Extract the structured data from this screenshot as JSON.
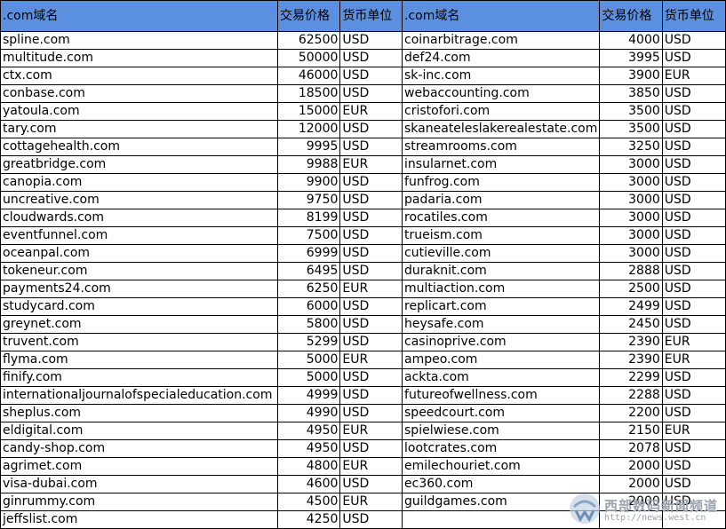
{
  "headers": {
    "domain": ".com域名",
    "price": "交易价格",
    "currency": "货币单位"
  },
  "left": [
    {
      "domain": "spline.com",
      "price": "62500",
      "currency": "USD"
    },
    {
      "domain": "multitude.com",
      "price": "50000",
      "currency": "USD"
    },
    {
      "domain": "ctx.com",
      "price": "46000",
      "currency": "USD"
    },
    {
      "domain": "conbase.com",
      "price": "18500",
      "currency": "USD"
    },
    {
      "domain": "yatoula.com",
      "price": "15000",
      "currency": "EUR"
    },
    {
      "domain": "tary.com",
      "price": "12000",
      "currency": "USD"
    },
    {
      "domain": "cottagehealth.com",
      "price": "9995",
      "currency": "USD"
    },
    {
      "domain": "greatbridge.com",
      "price": "9988",
      "currency": "EUR"
    },
    {
      "domain": "canopia.com",
      "price": "9900",
      "currency": "USD"
    },
    {
      "domain": "uncreative.com",
      "price": "9750",
      "currency": "USD"
    },
    {
      "domain": "cloudwards.com",
      "price": "8199",
      "currency": "USD"
    },
    {
      "domain": "eventfunnel.com",
      "price": "7500",
      "currency": "USD"
    },
    {
      "domain": "oceanpal.com",
      "price": "6999",
      "currency": "USD"
    },
    {
      "domain": "tokeneur.com",
      "price": "6495",
      "currency": "USD"
    },
    {
      "domain": "payments24.com",
      "price": "6250",
      "currency": "EUR"
    },
    {
      "domain": "studycard.com",
      "price": "6000",
      "currency": "USD"
    },
    {
      "domain": "greynet.com",
      "price": "5800",
      "currency": "USD"
    },
    {
      "domain": "truvent.com",
      "price": "5299",
      "currency": "USD"
    },
    {
      "domain": "flyma.com",
      "price": "5000",
      "currency": "EUR"
    },
    {
      "domain": "finify.com",
      "price": "5000",
      "currency": "USD"
    },
    {
      "domain": "internationaljournalofspecialeducation.com",
      "price": "4999",
      "currency": "USD"
    },
    {
      "domain": "sheplus.com",
      "price": "4990",
      "currency": "USD"
    },
    {
      "domain": "eldigital.com",
      "price": "4950",
      "currency": "EUR"
    },
    {
      "domain": "candy-shop.com",
      "price": "4950",
      "currency": "USD"
    },
    {
      "domain": "agrimet.com",
      "price": "4800",
      "currency": "EUR"
    },
    {
      "domain": "visa-dubai.com",
      "price": "4600",
      "currency": "USD"
    },
    {
      "domain": "ginrummy.com",
      "price": "4500",
      "currency": "EUR"
    },
    {
      "domain": "jeffslist.com",
      "price": "4250",
      "currency": "USD"
    }
  ],
  "right": [
    {
      "domain": "coinarbitrage.com",
      "price": "4000",
      "currency": "USD"
    },
    {
      "domain": "def24.com",
      "price": "3995",
      "currency": "USD"
    },
    {
      "domain": "sk-inc.com",
      "price": "3900",
      "currency": "EUR"
    },
    {
      "domain": "webaccounting.com",
      "price": "3850",
      "currency": "USD"
    },
    {
      "domain": "cristofori.com",
      "price": "3500",
      "currency": "USD"
    },
    {
      "domain": "skaneateleslakerealestate.com",
      "price": "3500",
      "currency": "USD"
    },
    {
      "domain": "streamrooms.com",
      "price": "3250",
      "currency": "USD"
    },
    {
      "domain": "insularnet.com",
      "price": "3000",
      "currency": "USD"
    },
    {
      "domain": "funfrog.com",
      "price": "3000",
      "currency": "USD"
    },
    {
      "domain": "padaria.com",
      "price": "3000",
      "currency": "USD"
    },
    {
      "domain": "rocatiles.com",
      "price": "3000",
      "currency": "USD"
    },
    {
      "domain": "trueism.com",
      "price": "3000",
      "currency": "USD"
    },
    {
      "domain": "cutieville.com",
      "price": "3000",
      "currency": "USD"
    },
    {
      "domain": "duraknit.com",
      "price": "2888",
      "currency": "USD"
    },
    {
      "domain": "multiaction.com",
      "price": "2500",
      "currency": "USD"
    },
    {
      "domain": "replicart.com",
      "price": "2499",
      "currency": "USD"
    },
    {
      "domain": "heysafe.com",
      "price": "2450",
      "currency": "USD"
    },
    {
      "domain": "casinoprive.com",
      "price": "2390",
      "currency": "EUR"
    },
    {
      "domain": "ampeo.com",
      "price": "2390",
      "currency": "EUR"
    },
    {
      "domain": "ackta.com",
      "price": "2299",
      "currency": "USD"
    },
    {
      "domain": "futureofwellness.com",
      "price": "2288",
      "currency": "USD"
    },
    {
      "domain": "speedcourt.com",
      "price": "2200",
      "currency": "USD"
    },
    {
      "domain": "spielwiese.com",
      "price": "2150",
      "currency": "EUR"
    },
    {
      "domain": "lootcrates.com",
      "price": "2078",
      "currency": "USD"
    },
    {
      "domain": "emilechouriet.com",
      "price": "2000",
      "currency": "USD"
    },
    {
      "domain": "ec360.com",
      "price": "2000",
      "currency": "USD"
    },
    {
      "domain": "guildgames.com",
      "price": "2000",
      "currency": "USD"
    }
  ],
  "watermark": {
    "title": "西部数码新闻频道",
    "url": "http://news.west.cn"
  },
  "colors": {
    "header_bg": "#5b8fe0",
    "watermark": "#9aa3ad"
  }
}
